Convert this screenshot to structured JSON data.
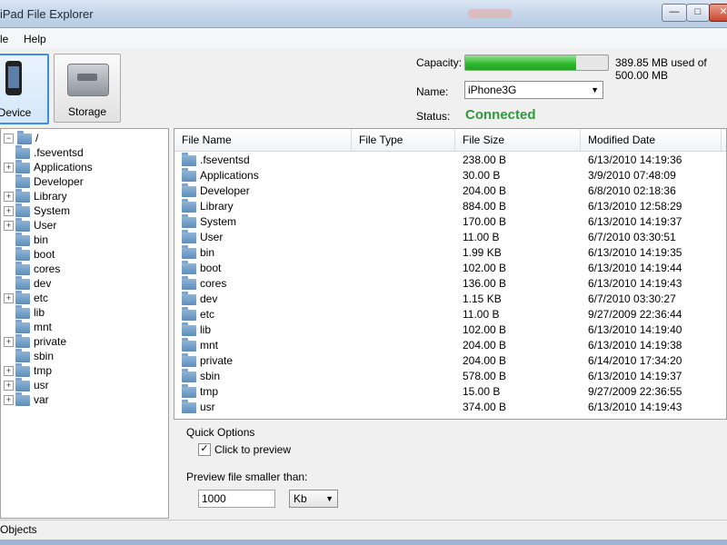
{
  "window": {
    "title": "iPad File Explorer"
  },
  "menu": {
    "items": [
      "File",
      "Help"
    ]
  },
  "toolbar": {
    "device_label": "Device",
    "storage_label": "Storage"
  },
  "device": {
    "capacity_label": "Capacity:",
    "capacity_fraction": 0.78,
    "capacity_text": "389.85 MB used of 500.00 MB",
    "name_label": "Name:",
    "name_value": "iPhone3G",
    "status_label": "Status:",
    "status_value": "Connected",
    "status_color": "#2e9a3a"
  },
  "tree": {
    "root": "/",
    "items": [
      {
        "label": ".fseventsd",
        "expandable": false
      },
      {
        "label": "Applications",
        "expandable": true
      },
      {
        "label": "Developer",
        "expandable": false
      },
      {
        "label": "Library",
        "expandable": true
      },
      {
        "label": "System",
        "expandable": true
      },
      {
        "label": "User",
        "expandable": true
      },
      {
        "label": "bin",
        "expandable": false
      },
      {
        "label": "boot",
        "expandable": false
      },
      {
        "label": "cores",
        "expandable": false
      },
      {
        "label": "dev",
        "expandable": false
      },
      {
        "label": "etc",
        "expandable": true
      },
      {
        "label": "lib",
        "expandable": false
      },
      {
        "label": "mnt",
        "expandable": false
      },
      {
        "label": "private",
        "expandable": true
      },
      {
        "label": "sbin",
        "expandable": false
      },
      {
        "label": "tmp",
        "expandable": true
      },
      {
        "label": "usr",
        "expandable": true
      },
      {
        "label": "var",
        "expandable": true
      }
    ]
  },
  "file_list": {
    "columns": [
      "File Name",
      "File Type",
      "File Size",
      "Modified Date"
    ],
    "rows": [
      {
        "name": ".fseventsd",
        "type": "",
        "size": "238.00 B",
        "date": "6/13/2010 14:19:36"
      },
      {
        "name": "Applications",
        "type": "",
        "size": "30.00 B",
        "date": "3/9/2010 07:48:09"
      },
      {
        "name": "Developer",
        "type": "",
        "size": "204.00 B",
        "date": "6/8/2010 02:18:36"
      },
      {
        "name": "Library",
        "type": "",
        "size": "884.00 B",
        "date": "6/13/2010 12:58:29"
      },
      {
        "name": "System",
        "type": "",
        "size": "170.00 B",
        "date": "6/13/2010 14:19:37"
      },
      {
        "name": "User",
        "type": "",
        "size": "11.00 B",
        "date": "6/7/2010 03:30:51"
      },
      {
        "name": "bin",
        "type": "",
        "size": "1.99 KB",
        "date": "6/13/2010 14:19:35"
      },
      {
        "name": "boot",
        "type": "",
        "size": "102.00 B",
        "date": "6/13/2010 14:19:44"
      },
      {
        "name": "cores",
        "type": "",
        "size": "136.00 B",
        "date": "6/13/2010 14:19:43"
      },
      {
        "name": "dev",
        "type": "",
        "size": "1.15 KB",
        "date": "6/7/2010 03:30:27"
      },
      {
        "name": "etc",
        "type": "",
        "size": "11.00 B",
        "date": "9/27/2009 22:36:44"
      },
      {
        "name": "lib",
        "type": "",
        "size": "102.00 B",
        "date": "6/13/2010 14:19:40"
      },
      {
        "name": "mnt",
        "type": "",
        "size": "204.00 B",
        "date": "6/13/2010 14:19:38"
      },
      {
        "name": "private",
        "type": "",
        "size": "204.00 B",
        "date": "6/14/2010 17:34:20"
      },
      {
        "name": "sbin",
        "type": "",
        "size": "578.00 B",
        "date": "6/13/2010 14:19:37"
      },
      {
        "name": "tmp",
        "type": "",
        "size": "15.00 B",
        "date": "9/27/2009 22:36:55"
      },
      {
        "name": "usr",
        "type": "",
        "size": "374.00 B",
        "date": "6/13/2010 14:19:43"
      }
    ]
  },
  "quick_options": {
    "title": "Quick Options",
    "click_to_preview_label": "Click to preview",
    "click_to_preview_checked": true,
    "preview_label": "Preview file smaller than:",
    "preview_value": "1000",
    "unit_value": "Kb"
  },
  "statusbar": {
    "text": "Objects"
  },
  "icons": {
    "folder": "folder-icon",
    "device": "phone-icon",
    "storage": "drive-icon"
  }
}
